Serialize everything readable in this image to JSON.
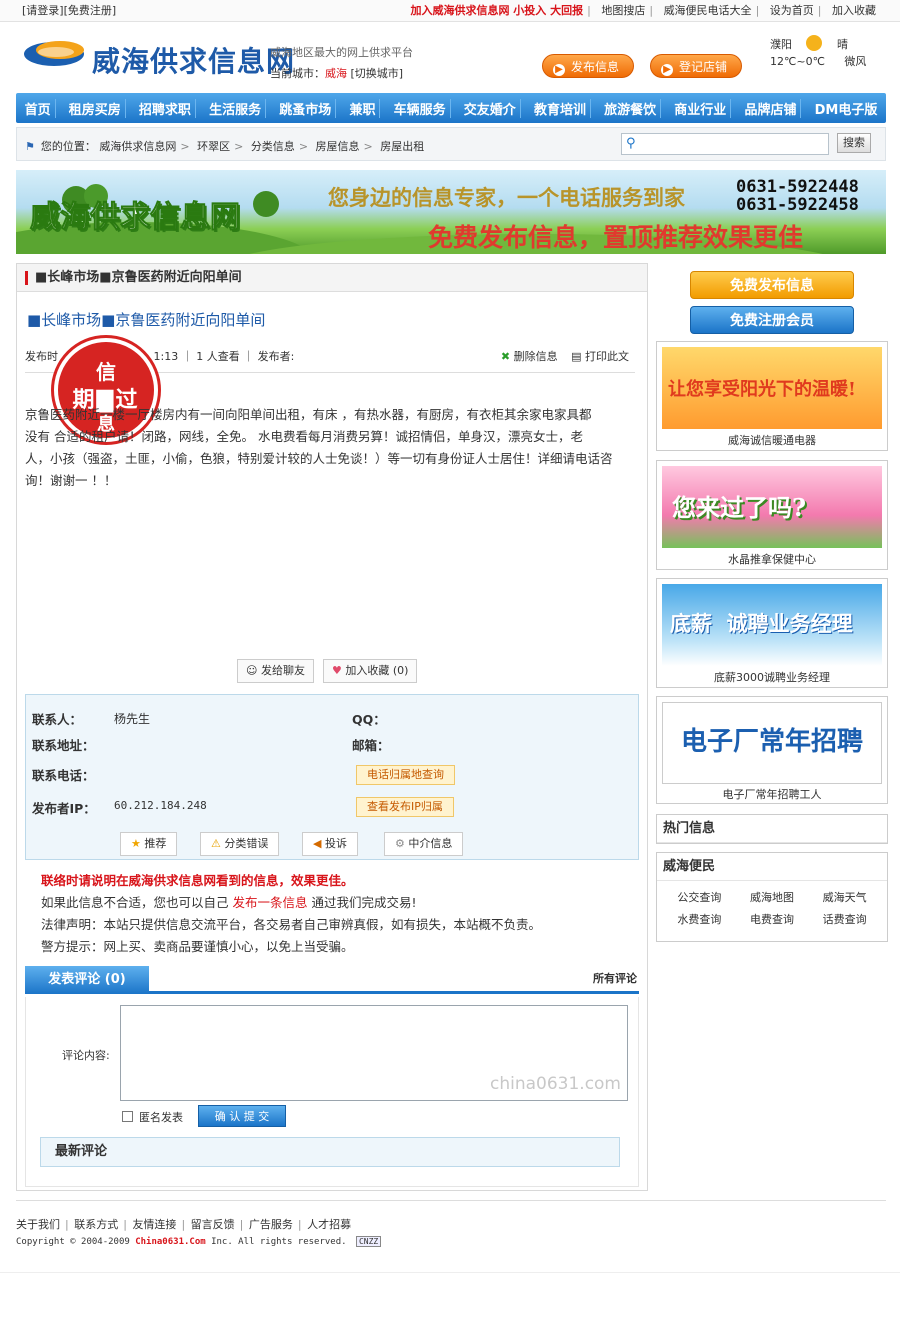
{
  "topbar": {
    "login": "[请登录]",
    "register": "[免费注册]",
    "promo": "加入威海供求信息网  小投入  大回报",
    "links": [
      "地图搜店",
      "威海便民电话大全",
      "设为首页",
      "加入收藏"
    ]
  },
  "header": {
    "site_name": "威海供求信息网",
    "slogan": "威海地区最大的网上供求平台",
    "city_label": "当前城市：",
    "city": "威海",
    "switch_city": "[切换城市]",
    "publish_btn": "发布信息",
    "register_shop_btn": "登记店铺",
    "weather": {
      "place": "濮阳",
      "temp": "12℃~0℃",
      "cond": "晴",
      "wind": "微风"
    }
  },
  "nav": [
    "首页",
    "租房买房",
    "招聘求职",
    "生活服务",
    "跳蚤市场",
    "兼职",
    "车辆服务",
    "交友婚介",
    "教育培训",
    "旅游餐饮",
    "商业行业",
    "品牌店铺",
    "DM电子版"
  ],
  "breadcrumb": {
    "prefix": "您的位置：",
    "items": [
      "威海供求信息网",
      "环翠区",
      "分类信息",
      "房屋信息",
      "房屋出租"
    ],
    "search_btn": "搜索"
  },
  "banner": {
    "title": "威海供求信息网",
    "line1": "您身边的信息专家，一个电话服务到家",
    "line2": "免费发布信息，置顶推荐效果更佳",
    "phones": [
      "0631-5922448",
      "0631-5922458"
    ]
  },
  "post": {
    "box_title": "■长峰市场■京鲁医药附近向阳单间",
    "title": "■长峰市场■京鲁医药附近向阳单间",
    "meta_a": "发布时",
    "meta_b": "1:13 ｜ 1 人查看 ｜ 发布者:",
    "delete": "删除信息",
    "print": "打印此文",
    "stamp": {
      "s1": "信",
      "s2": "期▇过",
      "s3": "息"
    },
    "body_lines": [
      "京鲁医药附近一楼一厅楼房内有一间向阳单间出租，有床 ，有热水器，有厨房，有衣柜其余家电家具都",
      "没有 合适的租户请！闭路，网线，全免。 水电费看每月消费另算！诚招情侣，单身汉，漂亮女士，老",
      "人，小孩（强盗，土匪，小偷，色狼，特别爱计较的人士免谈！）等一切有身份证人士居住！详细请电话咨",
      "询！谢谢一 ！！"
    ],
    "send_friend": "发给聊友",
    "favorite": "加入收藏 (0)"
  },
  "contact": {
    "person_label": "联系人：",
    "person": "杨先生",
    "qq_label": "QQ：",
    "addr_label": "联系地址：",
    "email_label": "邮箱：",
    "phone_label": "联系电话：",
    "phone_lookup": "电话归属地查询",
    "ip_label": "发布者IP：",
    "ip": "60.212.184.248",
    "ip_lookup": "查看发布IP归属",
    "actions": [
      "推荐",
      "分类错误",
      "投诉",
      "中介信息"
    ]
  },
  "notice": {
    "title": "联络时请说明在威海供求信息网看到的信息，效果更佳。",
    "l2a": "如果此信息不合适，您也可以自己",
    "l2link": "发布一条信息",
    "l2b": "通过我们完成交易!",
    "l3": "法律声明：本站只提供信息交流平台，各交易者自己审辨真假，如有损失，本站概不负责。",
    "l4": "警方提示：网上买、卖商品要谨慎小心，以免上当受骗。"
  },
  "comments": {
    "tab": "发表评论 (0)",
    "all": "所有评论",
    "label": "评论内容:",
    "watermark": "china0631.com",
    "anonymous": "匿名发表",
    "submit": "确 认 提 交",
    "latest": "最新评论"
  },
  "sidebar": {
    "btn_publish": "免费发布信息",
    "btn_register": "免费注册会员",
    "ads": [
      {
        "img_text": "让您享受阳光下的温暖!",
        "caption": "威海诚信暖通电器"
      },
      {
        "img_text": "您来过了吗?",
        "caption": "水晶推拿保健中心"
      },
      {
        "img_text": "底薪  诚聘业务经理",
        "caption": "底薪3000诚聘业务经理"
      },
      {
        "img_text": "电子厂常年招聘",
        "caption": "电子厂常年招聘工人"
      }
    ],
    "hot_title": "热门信息",
    "conv_title": "威海便民",
    "conv_links": [
      "公交查询",
      "威海地图",
      "威海天气",
      "水费查询",
      "电费查询",
      "话费查询"
    ]
  },
  "footer": {
    "links": [
      "关于我们",
      "联系方式",
      "友情连接",
      "留言反馈",
      "广告服务",
      "人才招募"
    ],
    "copy_a": "Copyright © 2004-2009 ",
    "copy_brand": "China0631.Com",
    "copy_b": " Inc. All rights reserved.",
    "cnzz": "CNZZ"
  }
}
